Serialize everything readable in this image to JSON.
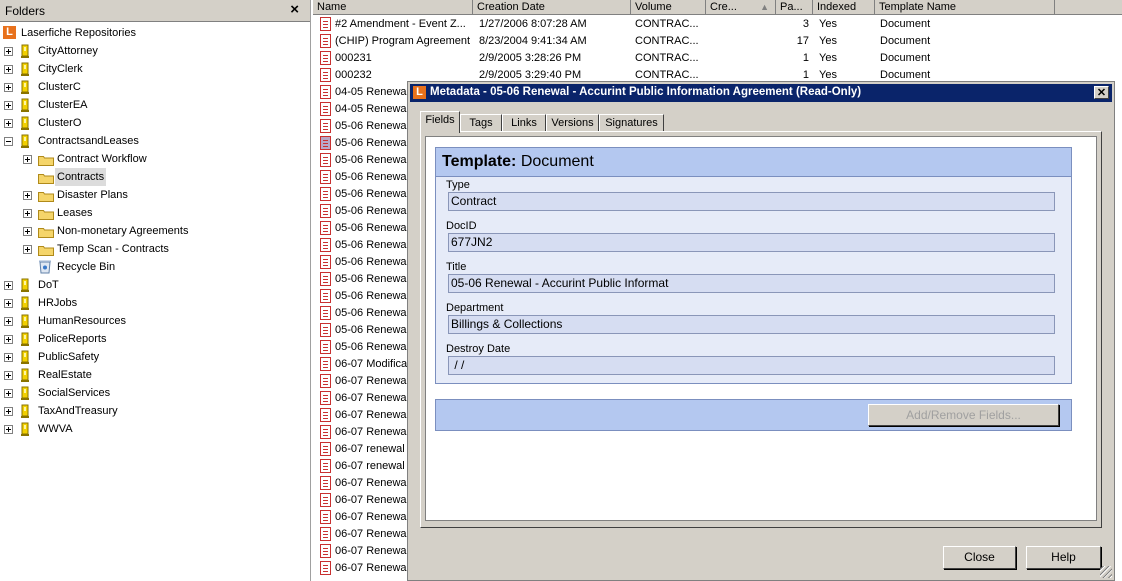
{
  "folders": {
    "title": "Folders",
    "close_glyph": "×",
    "repository": "Laserfiche Repositories",
    "logo_letter": "L",
    "items": [
      {
        "label": "CityAttorney",
        "level": 1,
        "type": "cabinet",
        "expander": "plus"
      },
      {
        "label": "CityClerk",
        "level": 1,
        "type": "cabinet",
        "expander": "plus"
      },
      {
        "label": "ClusterC",
        "level": 1,
        "type": "cabinet",
        "expander": "plus"
      },
      {
        "label": "ClusterEA",
        "level": 1,
        "type": "cabinet",
        "expander": "plus"
      },
      {
        "label": "ClusterO",
        "level": 1,
        "type": "cabinet",
        "expander": "plus"
      },
      {
        "label": "ContractsandLeases",
        "level": 1,
        "type": "cabinet",
        "expander": "minus"
      },
      {
        "label": "Contract Workflow",
        "level": 2,
        "type": "folder",
        "expander": "plus"
      },
      {
        "label": "Contracts",
        "level": 2,
        "type": "folder",
        "expander": "none",
        "selected": true
      },
      {
        "label": "Disaster Plans",
        "level": 2,
        "type": "folder",
        "expander": "plus"
      },
      {
        "label": "Leases",
        "level": 2,
        "type": "folder",
        "expander": "plus"
      },
      {
        "label": "Non-monetary Agreements",
        "level": 2,
        "type": "folder",
        "expander": "plus"
      },
      {
        "label": "Temp Scan - Contracts",
        "level": 2,
        "type": "folder",
        "expander": "plus"
      },
      {
        "label": "Recycle Bin",
        "level": 2,
        "type": "bin",
        "expander": "none"
      },
      {
        "label": "DoT",
        "level": 1,
        "type": "cabinet",
        "expander": "plus"
      },
      {
        "label": "HRJobs",
        "level": 1,
        "type": "cabinet",
        "expander": "plus"
      },
      {
        "label": "HumanResources",
        "level": 1,
        "type": "cabinet",
        "expander": "plus"
      },
      {
        "label": "PoliceReports",
        "level": 1,
        "type": "cabinet",
        "expander": "plus"
      },
      {
        "label": "PublicSafety",
        "level": 1,
        "type": "cabinet",
        "expander": "plus"
      },
      {
        "label": "RealEstate",
        "level": 1,
        "type": "cabinet",
        "expander": "plus"
      },
      {
        "label": "SocialServices",
        "level": 1,
        "type": "cabinet",
        "expander": "plus"
      },
      {
        "label": "TaxAndTreasury",
        "level": 1,
        "type": "cabinet",
        "expander": "plus"
      },
      {
        "label": "WWVA",
        "level": 1,
        "type": "cabinet",
        "expander": "plus"
      }
    ]
  },
  "list": {
    "columns": [
      "Name",
      "Creation Date",
      "Volume",
      "Cre...",
      "Pa...",
      "Indexed",
      "Template Name"
    ],
    "sort_glyph": "▲",
    "rows": [
      {
        "name": "#2 Amendment - Event Z...",
        "date": "1/27/2006 8:07:28 AM",
        "volume": "CONTRAC...",
        "pages": "3",
        "indexed": "Yes",
        "template": "Document"
      },
      {
        "name": "(CHIP) Program Agreement",
        "date": "8/23/2004 9:41:34 AM",
        "volume": "CONTRAC...",
        "pages": "17",
        "indexed": "Yes",
        "template": "Document"
      },
      {
        "name": "000231",
        "date": "2/9/2005 3:28:26 PM",
        "volume": "CONTRAC...",
        "pages": "1",
        "indexed": "Yes",
        "template": "Document"
      },
      {
        "name": "000232",
        "date": "2/9/2005 3:29:40 PM",
        "volume": "CONTRAC...",
        "pages": "1",
        "indexed": "Yes",
        "template": "Document"
      },
      {
        "name": "04-05 Renewa"
      },
      {
        "name": "04-05 Renewa"
      },
      {
        "name": "05-06 Renewa"
      },
      {
        "name": "05-06 Renewa",
        "selected": true
      },
      {
        "name": "05-06 Renewa"
      },
      {
        "name": "05-06 Renewa"
      },
      {
        "name": "05-06 Renewa"
      },
      {
        "name": "05-06 Renewa"
      },
      {
        "name": "05-06 Renewa"
      },
      {
        "name": "05-06 Renewa"
      },
      {
        "name": "05-06 Renewa"
      },
      {
        "name": "05-06 Renewa"
      },
      {
        "name": "05-06 Renewa"
      },
      {
        "name": "05-06 Renewa"
      },
      {
        "name": "05-06 Renewa"
      },
      {
        "name": "05-06 Renewa"
      },
      {
        "name": "06-07 Modifica"
      },
      {
        "name": "06-07 Renewa"
      },
      {
        "name": "06-07 Renewa"
      },
      {
        "name": "06-07 Renewa"
      },
      {
        "name": "06-07 Renewa"
      },
      {
        "name": "06-07 renewal"
      },
      {
        "name": "06-07 renewal"
      },
      {
        "name": "06-07 Renewa"
      },
      {
        "name": "06-07 Renewa"
      },
      {
        "name": "06-07 Renewa"
      },
      {
        "name": "06-07 Renewa"
      },
      {
        "name": "06-07 Renewa"
      },
      {
        "name": "06-07 Renewa"
      }
    ]
  },
  "dialog": {
    "title": "Metadata - 05-06 Renewal - Accurint Public Information Agreement (Read-Only)",
    "logo_letter": "L",
    "close_glyph": "✕",
    "tabs": [
      "Fields",
      "Tags",
      "Links",
      "Versions",
      "Signatures"
    ],
    "active_tab": "Fields",
    "template_label": "Template:",
    "template_name": "Document",
    "fields": [
      {
        "label": "Type",
        "value": "Contract"
      },
      {
        "label": "DocID",
        "value": "677JN2"
      },
      {
        "label": "Title",
        "value": "05-06 Renewal - Accurint Public Informat"
      },
      {
        "label": "Department",
        "value": "Billings & Collections"
      },
      {
        "label": "Destroy Date",
        "value": " / /"
      }
    ],
    "add_remove_label": "Add/Remove Fields...",
    "close_label": "Close",
    "help_label": "Help"
  },
  "colors": {
    "title_bar": "#0a246a",
    "template_header": "#b4c8f0",
    "field_bg": "#d6ddf2",
    "logo": "#e8711c"
  }
}
